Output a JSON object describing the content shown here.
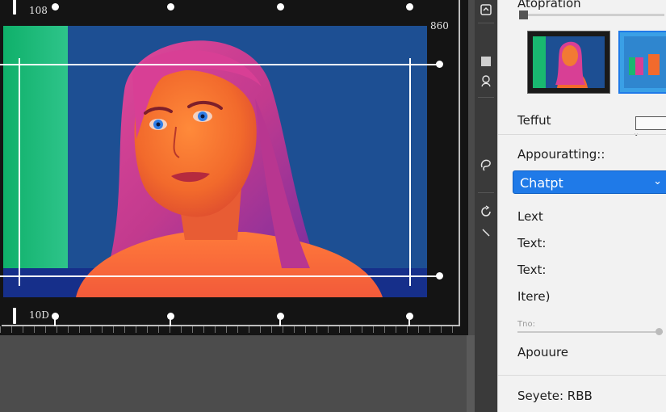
{
  "canvas": {
    "ruler_top_left": "108",
    "ruler_top_right": "860",
    "ruler_bottom_left": "10D"
  },
  "panel": {
    "title": "Atopration",
    "row_teffut": "Teffut",
    "section_appearance": "Appouratting::",
    "dropdown_value": "Chatpt",
    "item_lext": "Lext",
    "item_text1": "Text:",
    "item_text2": "Text:",
    "item_itere": "Itere)",
    "small_label": "Tno:",
    "item_apouure": "Apouure",
    "footer": "Seyete: RBB"
  },
  "icons": {
    "tools": [
      "export-icon",
      "portrait-icon",
      "square-icon",
      "lasso-icon",
      "brush-icon",
      "rotate-icon"
    ],
    "dropdown": "chevron-down-icon"
  },
  "colors": {
    "accent": "#1f7ae8",
    "canvas_bg": "#141414",
    "panel_bg": "#f2f2f2"
  }
}
